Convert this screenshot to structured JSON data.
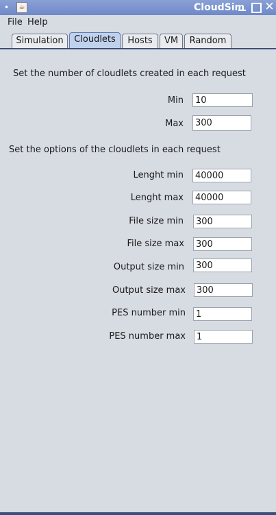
{
  "window": {
    "title": "CloudSim",
    "icon": "java-icon",
    "controls": [
      "minimize",
      "maximize",
      "close"
    ]
  },
  "menubar": {
    "file": "File",
    "help": "Help"
  },
  "tabs": {
    "simulation": "Simulation",
    "cloudlets": "Cloudlets",
    "hosts": "Hosts",
    "vm": "VM",
    "random": "Random",
    "active": "Cloudlets"
  },
  "cloudlets_per_request": {
    "heading": "Set the number of cloudlets created in each request",
    "min_label": "Min",
    "min_value": "10",
    "max_label": "Max",
    "max_value": "300"
  },
  "cloudlet_options": {
    "heading": "Set the options of the cloudlets in each request",
    "length_min_label": "Lenght min",
    "length_min_value": "40000",
    "length_max_label": "Lenght max",
    "length_max_value": "40000",
    "file_size_min_label": "File size min",
    "file_size_min_value": "300",
    "file_size_max_label": "File size max",
    "file_size_max_value": "300",
    "output_size_min_label": "Output size min",
    "output_size_min_value": "300",
    "output_size_max_label": "Output size max",
    "output_size_max_value": "300",
    "pes_min_label": "PES number min",
    "pes_min_value": "1",
    "pes_max_label": "PES number max",
    "pes_max_value": "1"
  }
}
